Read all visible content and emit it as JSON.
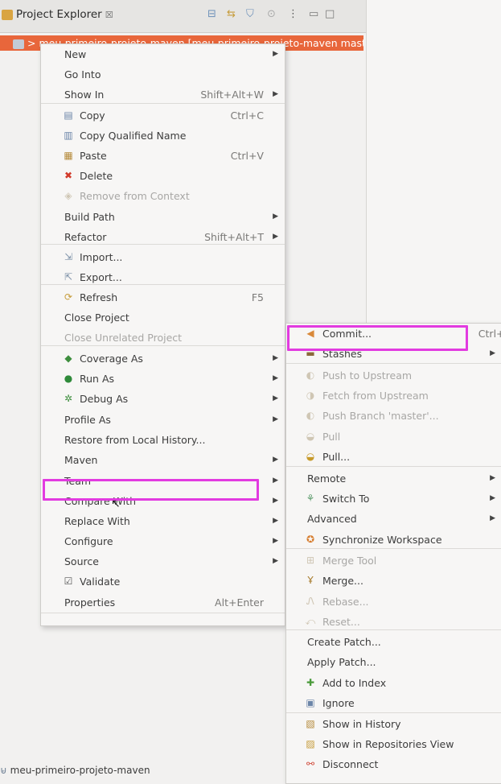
{
  "view": {
    "tab_title": "Project Explorer",
    "tab_close": "☒",
    "selected_project": "> meu-primeiro-projeto-maven [meu-primeiro-projeto-maven master]",
    "bottom_project": "meu-primeiro-projeto-maven"
  },
  "context_menu": {
    "items": [
      {
        "label": "New",
        "shortcut": "",
        "submenu": true,
        "icon": "",
        "disabled": false
      },
      {
        "label": "Go Into",
        "shortcut": "",
        "submenu": false,
        "icon": "",
        "disabled": false
      },
      {
        "label": "Show In",
        "shortcut": "Shift+Alt+W",
        "submenu": true,
        "icon": "",
        "disabled": false
      },
      {
        "label": "Copy",
        "shortcut": "Ctrl+C",
        "submenu": false,
        "icon": "copy-icon",
        "disabled": false
      },
      {
        "label": "Copy Qualified Name",
        "shortcut": "",
        "submenu": false,
        "icon": "copy-qualified-icon",
        "disabled": false
      },
      {
        "label": "Paste",
        "shortcut": "Ctrl+V",
        "submenu": false,
        "icon": "paste-icon",
        "disabled": false
      },
      {
        "label": "Delete",
        "shortcut": "",
        "submenu": false,
        "icon": "delete-icon",
        "disabled": false
      },
      {
        "label": "Remove from Context",
        "shortcut": "",
        "submenu": false,
        "icon": "remove-context-icon",
        "disabled": true
      },
      {
        "label": "Build Path",
        "shortcut": "",
        "submenu": true,
        "icon": "",
        "disabled": false
      },
      {
        "label": "Refactor",
        "shortcut": "Shift+Alt+T",
        "submenu": true,
        "icon": "",
        "disabled": false
      },
      {
        "label": "Import...",
        "shortcut": "",
        "submenu": false,
        "icon": "import-icon",
        "disabled": false
      },
      {
        "label": "Export...",
        "shortcut": "",
        "submenu": false,
        "icon": "export-icon",
        "disabled": false
      },
      {
        "label": "Refresh",
        "shortcut": "F5",
        "submenu": false,
        "icon": "refresh-icon",
        "disabled": false
      },
      {
        "label": "Close Project",
        "shortcut": "",
        "submenu": false,
        "icon": "",
        "disabled": false
      },
      {
        "label": "Close Unrelated Project",
        "shortcut": "",
        "submenu": false,
        "icon": "",
        "disabled": true
      },
      {
        "label": "Coverage As",
        "shortcut": "",
        "submenu": true,
        "icon": "coverage-icon",
        "disabled": false
      },
      {
        "label": "Run As",
        "shortcut": "",
        "submenu": true,
        "icon": "run-icon",
        "disabled": false
      },
      {
        "label": "Debug As",
        "shortcut": "",
        "submenu": true,
        "icon": "debug-icon",
        "disabled": false
      },
      {
        "label": "Profile As",
        "shortcut": "",
        "submenu": true,
        "icon": "",
        "disabled": false
      },
      {
        "label": "Restore from Local History...",
        "shortcut": "",
        "submenu": false,
        "icon": "",
        "disabled": false
      },
      {
        "label": "Maven",
        "shortcut": "",
        "submenu": true,
        "icon": "",
        "disabled": false
      },
      {
        "label": "Team",
        "shortcut": "",
        "submenu": true,
        "icon": "",
        "disabled": false
      },
      {
        "label": "Compare With",
        "shortcut": "",
        "submenu": true,
        "icon": "",
        "disabled": false
      },
      {
        "label": "Replace With",
        "shortcut": "",
        "submenu": true,
        "icon": "",
        "disabled": false
      },
      {
        "label": "Configure",
        "shortcut": "",
        "submenu": true,
        "icon": "",
        "disabled": false
      },
      {
        "label": "Source",
        "shortcut": "",
        "submenu": true,
        "icon": "",
        "disabled": false
      },
      {
        "label": "Validate",
        "shortcut": "",
        "submenu": false,
        "icon": "checkbox-icon",
        "disabled": false
      },
      {
        "label": "Properties",
        "shortcut": "Alt+Enter",
        "submenu": false,
        "icon": "",
        "disabled": false
      }
    ]
  },
  "team_menu": {
    "items": [
      {
        "label": "Commit...",
        "shortcut": "Ctrl+#",
        "submenu": false,
        "icon": "commit-icon",
        "disabled": false
      },
      {
        "label": "Stashes",
        "shortcut": "",
        "submenu": true,
        "icon": "stashes-icon",
        "disabled": false
      },
      {
        "label": "Push to Upstream",
        "shortcut": "",
        "submenu": false,
        "icon": "push-upstream-icon",
        "disabled": true
      },
      {
        "label": "Fetch from Upstream",
        "shortcut": "",
        "submenu": false,
        "icon": "fetch-upstream-icon",
        "disabled": true
      },
      {
        "label": "Push Branch 'master'...",
        "shortcut": "",
        "submenu": false,
        "icon": "push-branch-icon",
        "disabled": true
      },
      {
        "label": "Pull",
        "shortcut": "",
        "submenu": false,
        "icon": "pull-icon",
        "disabled": true
      },
      {
        "label": "Pull...",
        "shortcut": "",
        "submenu": false,
        "icon": "pull-dialog-icon",
        "disabled": false
      },
      {
        "label": "Remote",
        "shortcut": "",
        "submenu": true,
        "icon": "",
        "disabled": false
      },
      {
        "label": "Switch To",
        "shortcut": "",
        "submenu": true,
        "icon": "switch-icon",
        "disabled": false
      },
      {
        "label": "Advanced",
        "shortcut": "",
        "submenu": true,
        "icon": "",
        "disabled": false
      },
      {
        "label": "Synchronize Workspace",
        "shortcut": "",
        "submenu": false,
        "icon": "synchronize-icon",
        "disabled": false
      },
      {
        "label": "Merge Tool",
        "shortcut": "",
        "submenu": false,
        "icon": "merge-tool-icon",
        "disabled": true
      },
      {
        "label": "Merge...",
        "shortcut": "",
        "submenu": false,
        "icon": "merge-icon",
        "disabled": false
      },
      {
        "label": "Rebase...",
        "shortcut": "",
        "submenu": false,
        "icon": "rebase-icon",
        "disabled": true
      },
      {
        "label": "Reset...",
        "shortcut": "",
        "submenu": false,
        "icon": "reset-icon",
        "disabled": true
      },
      {
        "label": "Create Patch...",
        "shortcut": "",
        "submenu": false,
        "icon": "",
        "disabled": false
      },
      {
        "label": "Apply Patch...",
        "shortcut": "",
        "submenu": false,
        "icon": "",
        "disabled": false
      },
      {
        "label": "Add to Index",
        "shortcut": "",
        "submenu": false,
        "icon": "add-index-icon",
        "disabled": false
      },
      {
        "label": "Ignore",
        "shortcut": "",
        "submenu": false,
        "icon": "ignore-icon",
        "disabled": false
      },
      {
        "label": "Show in History",
        "shortcut": "",
        "submenu": false,
        "icon": "history-icon",
        "disabled": false
      },
      {
        "label": "Show in Repositories View",
        "shortcut": "",
        "submenu": false,
        "icon": "repositories-icon",
        "disabled": false
      },
      {
        "label": "Disconnect",
        "shortcut": "",
        "submenu": false,
        "icon": "disconnect-icon",
        "disabled": false
      }
    ]
  },
  "highlight_color": "#e23be0",
  "selection_color": "#e8663b"
}
